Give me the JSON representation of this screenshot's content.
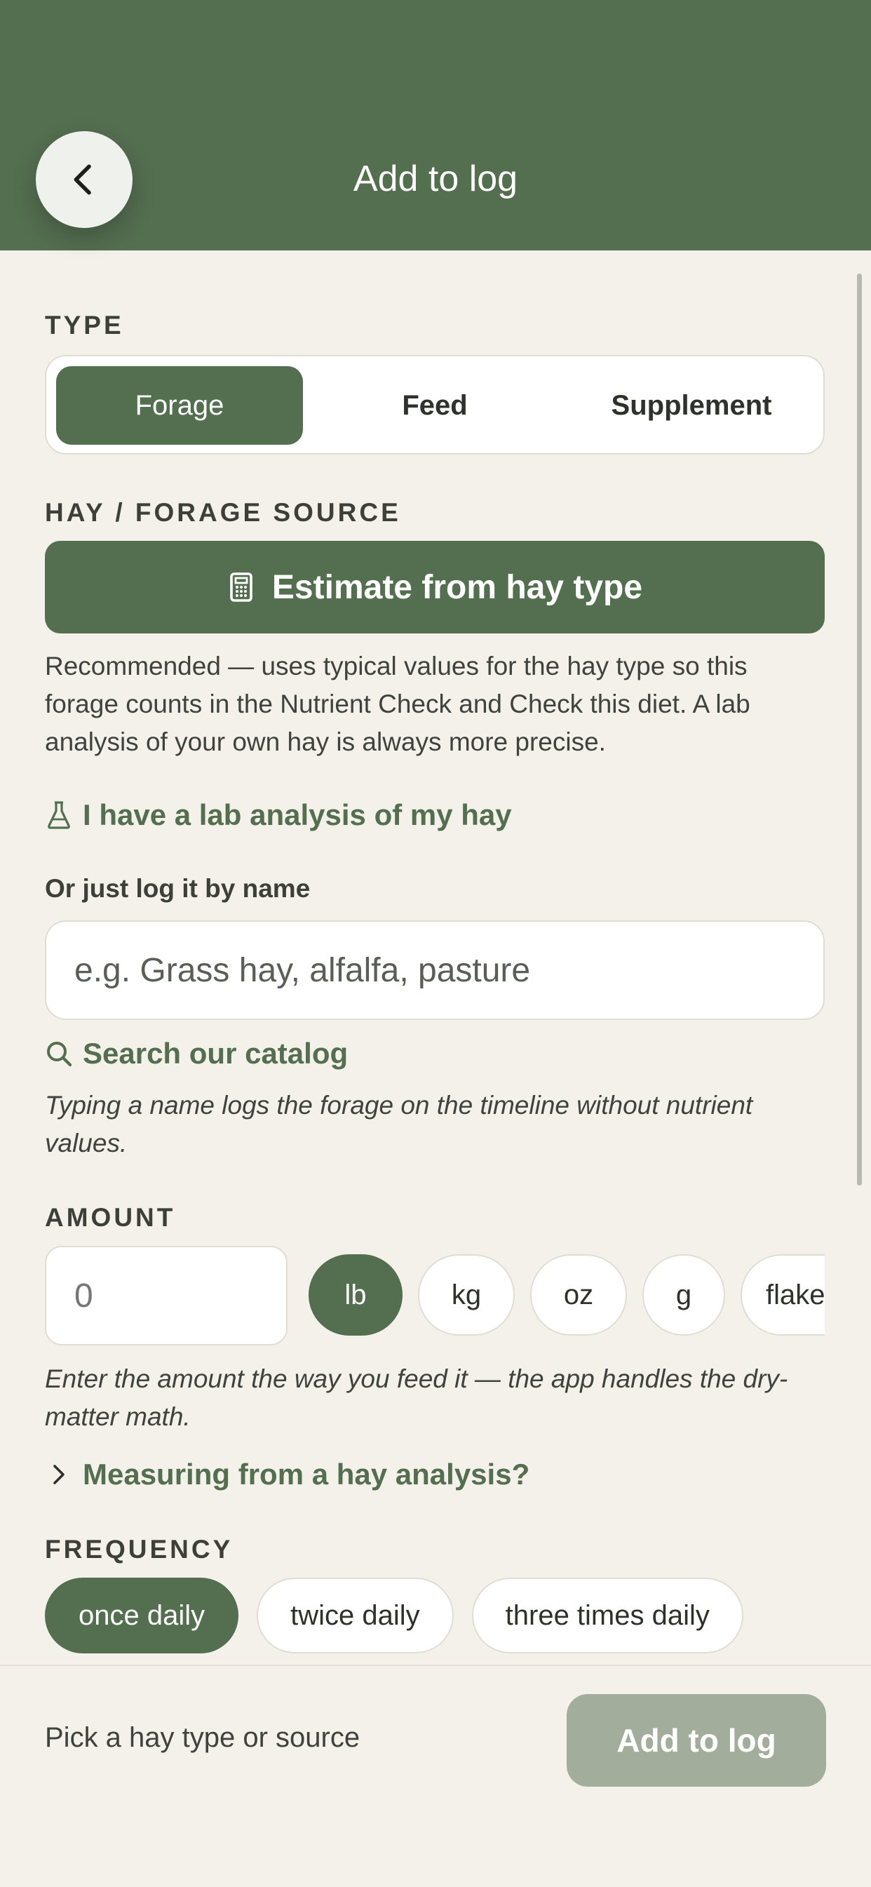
{
  "header": {
    "title": "Add to log",
    "back_icon": "chevron-left-icon"
  },
  "type_section": {
    "label": "TYPE",
    "options": [
      "Forage",
      "Feed",
      "Supplement"
    ],
    "selected": "Forage"
  },
  "source_section": {
    "label": "HAY / FORAGE SOURCE",
    "estimate_button": {
      "icon": "calculator-icon",
      "label": "Estimate from hay type"
    },
    "recommendation": "Recommended — uses typical values for the hay type so this forage counts in the Nutrient Check and Check this diet. A lab analysis of your own hay is always more precise.",
    "lab_link": {
      "icon": "flask-icon",
      "label": "I have a lab analysis of my hay"
    },
    "name_field": {
      "label": "Or just log it by name",
      "value": "",
      "placeholder": "e.g. Grass hay, alfalfa, pasture"
    },
    "catalog_link": {
      "icon": "search-icon",
      "label": "Search our catalog"
    },
    "name_note": "Typing a name logs the forage on the timeline without nutrient values."
  },
  "amount_section": {
    "label": "AMOUNT",
    "value": "",
    "placeholder": "0",
    "units": [
      "lb",
      "kg",
      "oz",
      "g",
      "flakes"
    ],
    "selected_unit": "lb",
    "note": "Enter the amount the way you feed it — the app handles the dry-matter math.",
    "analysis_link": {
      "icon": "chevron-right-icon",
      "label": "Measuring from a hay analysis?"
    }
  },
  "frequency_section": {
    "label": "FREQUENCY",
    "options": [
      "once daily",
      "twice daily",
      "three times daily"
    ],
    "selected": "once daily"
  },
  "footer": {
    "hint": "Pick a hay type or source",
    "button_label": "Add to log",
    "button_enabled": false
  },
  "colors": {
    "primary": "#546e50",
    "background": "#f4f0ea",
    "disabled_button": "#a2ad9c"
  }
}
